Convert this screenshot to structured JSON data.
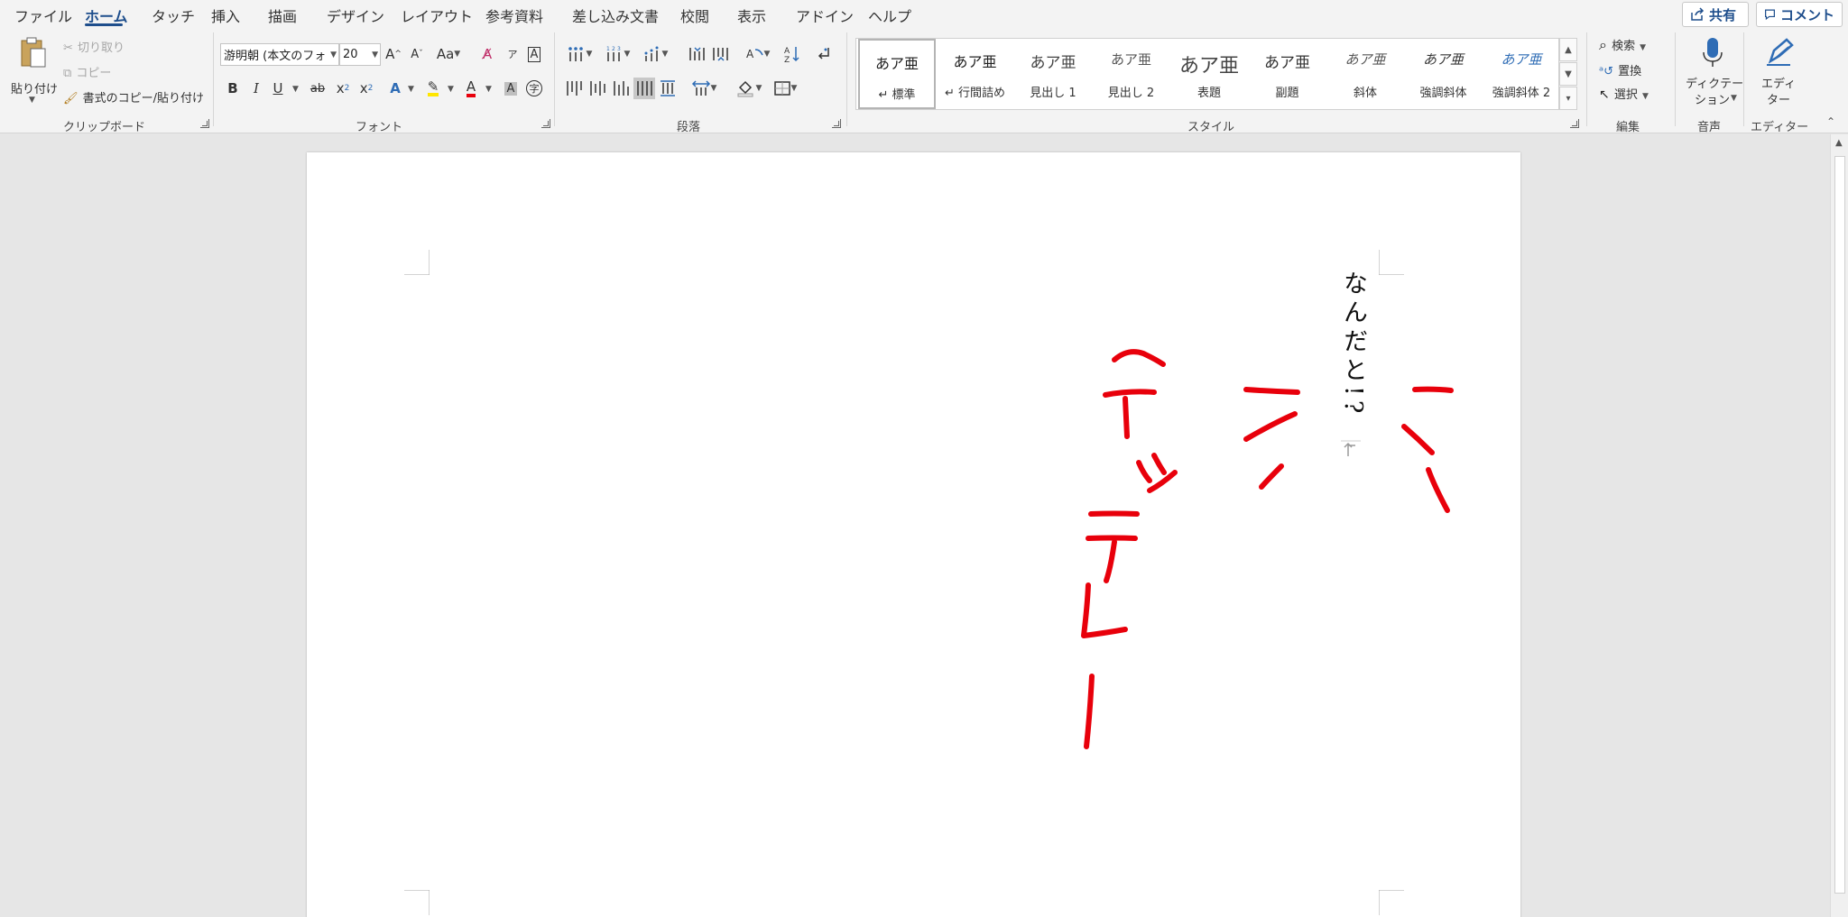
{
  "tabs": [
    {
      "label": "ファイル",
      "active": false
    },
    {
      "label": "ホーム",
      "active": true
    },
    {
      "label": "タッチ",
      "active": false
    },
    {
      "label": "挿入",
      "active": false
    },
    {
      "label": "描画",
      "active": false
    },
    {
      "label": "デザイン",
      "active": false
    },
    {
      "label": "レイアウト",
      "active": false
    },
    {
      "label": "参考資料",
      "active": false
    },
    {
      "label": "差し込み文書",
      "active": false
    },
    {
      "label": "校閲",
      "active": false
    },
    {
      "label": "表示",
      "active": false
    },
    {
      "label": "アドイン",
      "active": false
    },
    {
      "label": "ヘルプ",
      "active": false
    }
  ],
  "top_buttons": {
    "share": "共有",
    "comment": "コメント"
  },
  "clipboard": {
    "paste": "貼り付け",
    "cut": "切り取り",
    "copy": "コピー",
    "format_painter": "書式のコピー/貼り付け",
    "group_label": "クリップボード"
  },
  "font": {
    "name": "游明朝 (本文のフォ",
    "size": "20",
    "group_label": "フォント",
    "change_case": "Aa",
    "bold": "B",
    "italic": "I",
    "underline": "U",
    "strike": "ab",
    "subscript": "x",
    "superscript": "x",
    "grow": "A",
    "shrink": "A",
    "font_color_letter": "A",
    "char_shading": "A",
    "enclose": "字"
  },
  "paragraph": {
    "group_label": "段落"
  },
  "styles": {
    "group_label": "スタイル",
    "items": [
      {
        "sample": "あア亜",
        "name": "標準",
        "mark": "↵",
        "selected": true,
        "color": "#222222"
      },
      {
        "sample": "あア亜",
        "name": "行間詰め",
        "mark": "↵",
        "selected": false,
        "color": "#222222"
      },
      {
        "sample": "あア亜",
        "name": "見出し 1",
        "mark": "",
        "selected": false,
        "color": "#444444"
      },
      {
        "sample": "あア亜",
        "name": "見出し 2",
        "mark": "",
        "selected": false,
        "color": "#555555"
      },
      {
        "sample": "あア亜",
        "name": "表題",
        "mark": "",
        "selected": false,
        "color": "#444444"
      },
      {
        "sample": "あア亜",
        "name": "副題",
        "mark": "",
        "selected": false,
        "color": "#333333"
      },
      {
        "sample": "あア亜",
        "name": "斜体",
        "mark": "",
        "selected": false,
        "color": "#555555"
      },
      {
        "sample": "あア亜",
        "name": "強調斜体",
        "mark": "",
        "selected": false,
        "color": "#333333"
      },
      {
        "sample": "あア亜",
        "name": "強調斜体 2",
        "mark": "",
        "selected": false,
        "color": "#2e6cb5"
      }
    ]
  },
  "editing": {
    "search": "検索",
    "replace": "置換",
    "select": "選択",
    "group_label": "編集"
  },
  "voice": {
    "dictate_line1": "ディクテー",
    "dictate_line2": "ション",
    "group_label": "音声"
  },
  "editor": {
    "line1": "エディ",
    "line2": "ター",
    "group_label": "エディター"
  },
  "document": {
    "vertical_text": "なんだと!?",
    "ink_color": "#e8000b",
    "handwriting_columns": [
      "ミ",
      "ン",
      "ヘッテレー"
    ]
  }
}
